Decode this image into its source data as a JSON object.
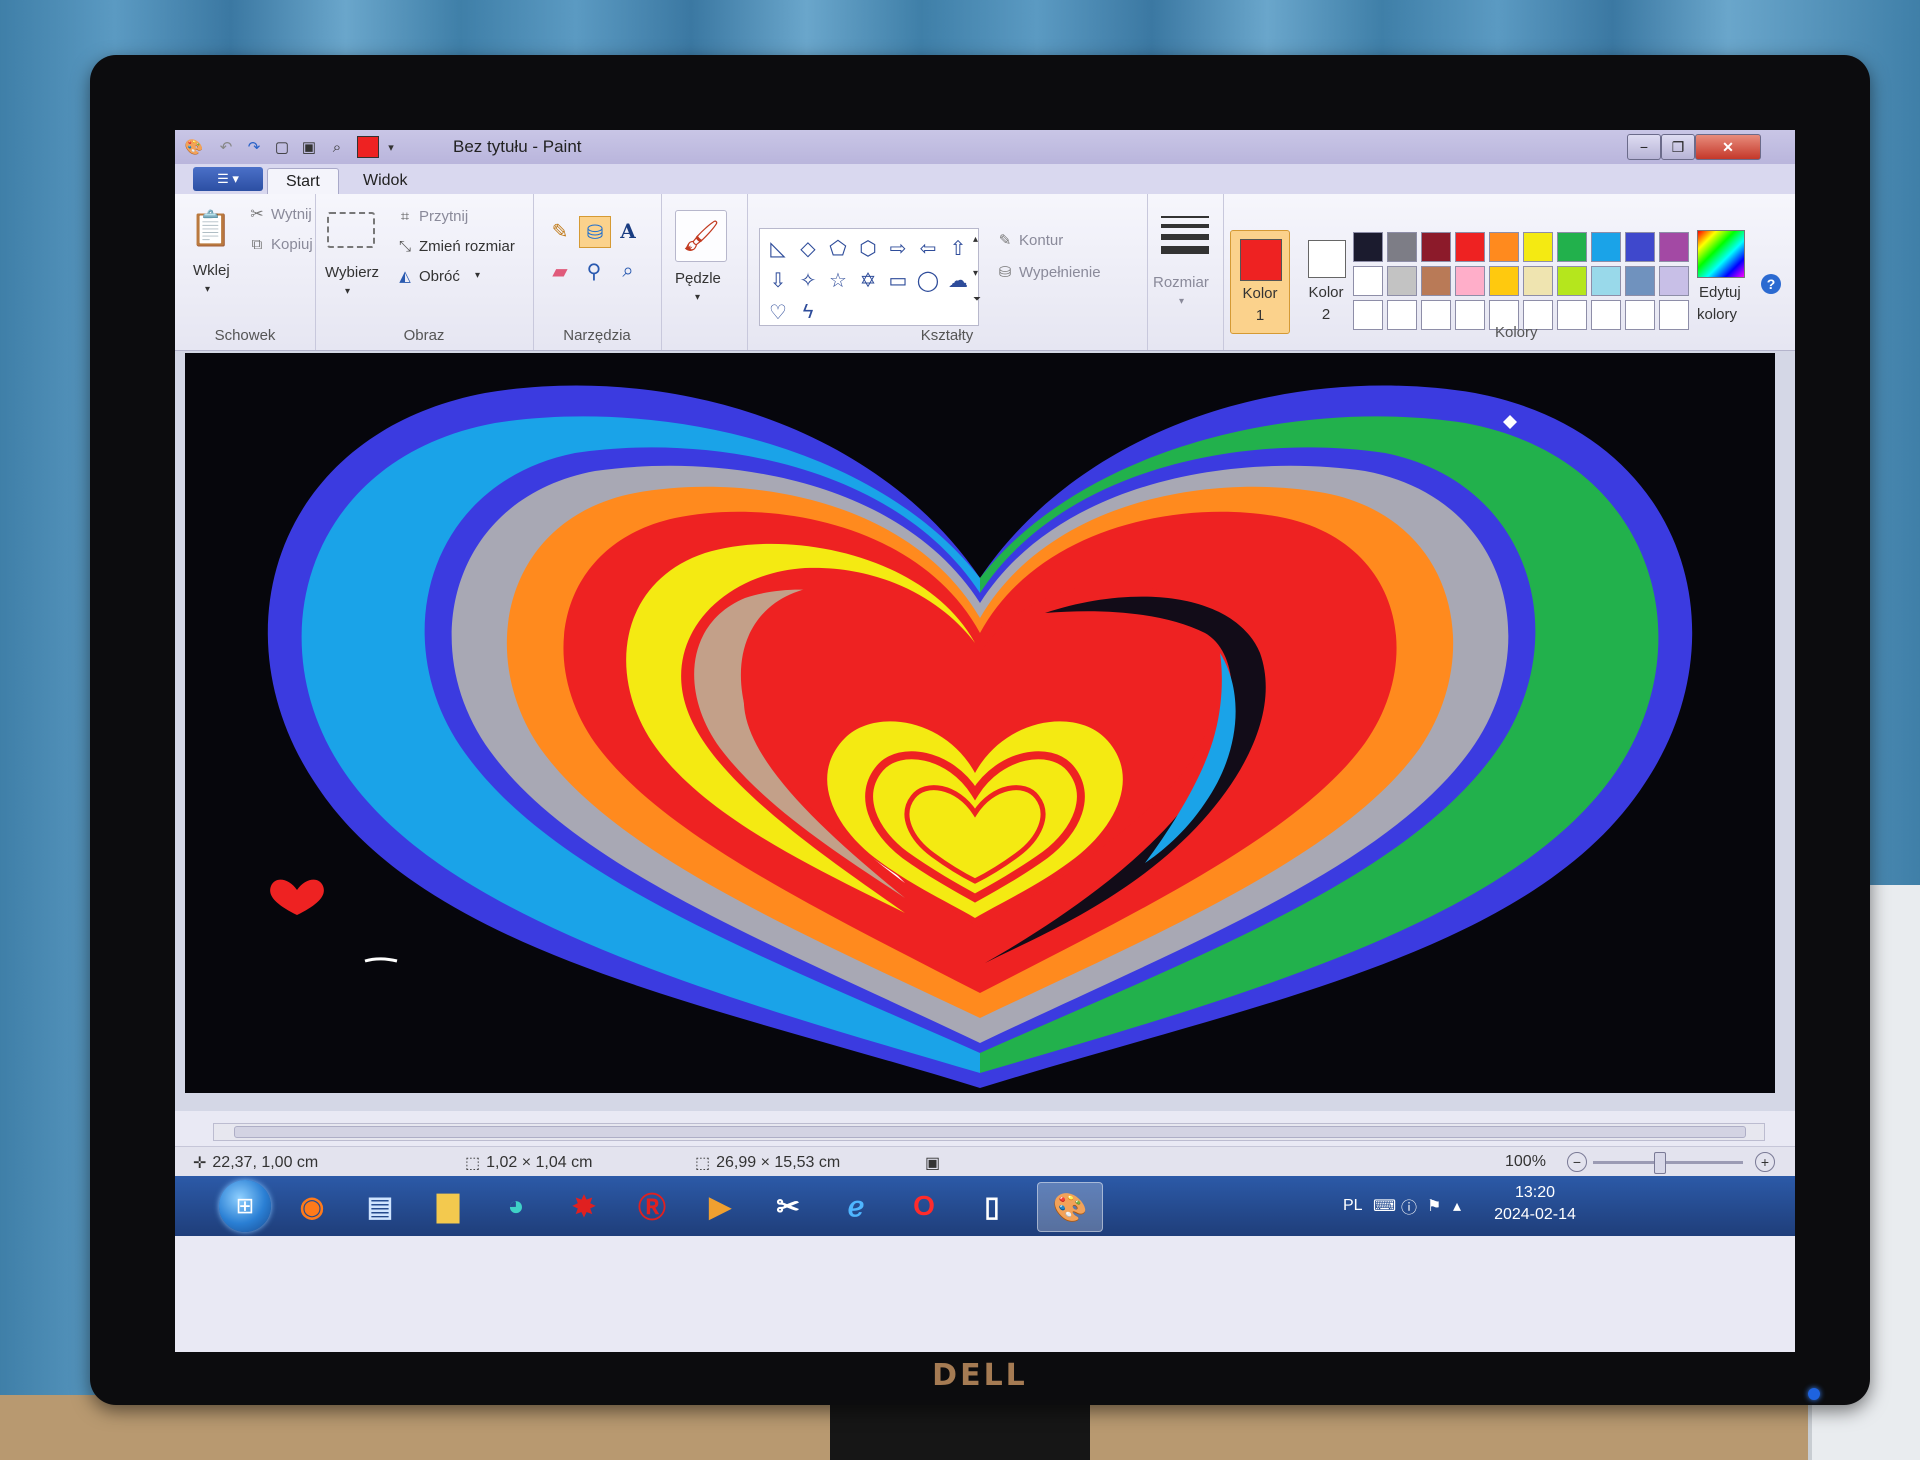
{
  "window": {
    "title": "Bez tytułu - Paint"
  },
  "tabs": [
    {
      "label": "Start"
    },
    {
      "label": "Widok"
    }
  ],
  "ribbon": {
    "clipboard": {
      "paste": "Wklej",
      "cut": "Wytnij",
      "copy": "Kopiuj",
      "group": "Schowek"
    },
    "image": {
      "select": "Wybierz",
      "crop": "Przytnij",
      "resize": "Zmień rozmiar",
      "rotate": "Obróć",
      "group": "Obraz"
    },
    "tools": {
      "group": "Narzędzia"
    },
    "brushes": {
      "label": "Pędzle"
    },
    "shapes": {
      "outline": "Kontur",
      "fill": "Wypełnienie",
      "group": "Kształty"
    },
    "size": {
      "label": "Rozmiar"
    },
    "colors": {
      "color1_label": "Kolor",
      "color1_num": "1",
      "color2_label": "Kolor",
      "color2_num": "2",
      "edit_line1": "Edytuj",
      "edit_line2": "kolory",
      "group": "Kolory",
      "color1": "#ee2222",
      "color2": "#ffffff",
      "palette": [
        "#1b1b2e",
        "#7d7d86",
        "#8c1a2a",
        "#ee2222",
        "#ff8a1e",
        "#f4ea12",
        "#22b14c",
        "#1aa3e8",
        "#3f48cc",
        "#a349a4",
        "#ffffff",
        "#c3c3c3",
        "#b97a57",
        "#ffaec9",
        "#ffc90e",
        "#efe4b0",
        "#b5e61d",
        "#99d9ea",
        "#7092be",
        "#c8bfe7",
        "#ffffff",
        "#ffffff",
        "#ffffff",
        "#ffffff",
        "#ffffff",
        "#ffffff",
        "#ffffff",
        "#ffffff",
        "#ffffff",
        "#ffffff"
      ]
    }
  },
  "status": {
    "cursor_pos": "22,37, 1,00 cm",
    "selection_size": "1,02 × 1,04 cm",
    "image_size": "26,99 × 15,53 cm",
    "zoom": "100%"
  },
  "taskbar": {
    "language": "PL",
    "time": "13:20",
    "date": "2024-02-14",
    "apps": [
      "windows-start-icon",
      "firefox-icon",
      "notepad-icon",
      "folder-icon",
      "edge-icon",
      "paint-splash-icon",
      "r-app-icon",
      "media-player-icon",
      "snipping-icon",
      "internet-explorer-icon",
      "opera-icon",
      "document-icon",
      "paint-icon"
    ]
  },
  "monitor": {
    "brand": "DELL"
  },
  "canvas": {
    "drawing": "rainbow-heart"
  }
}
